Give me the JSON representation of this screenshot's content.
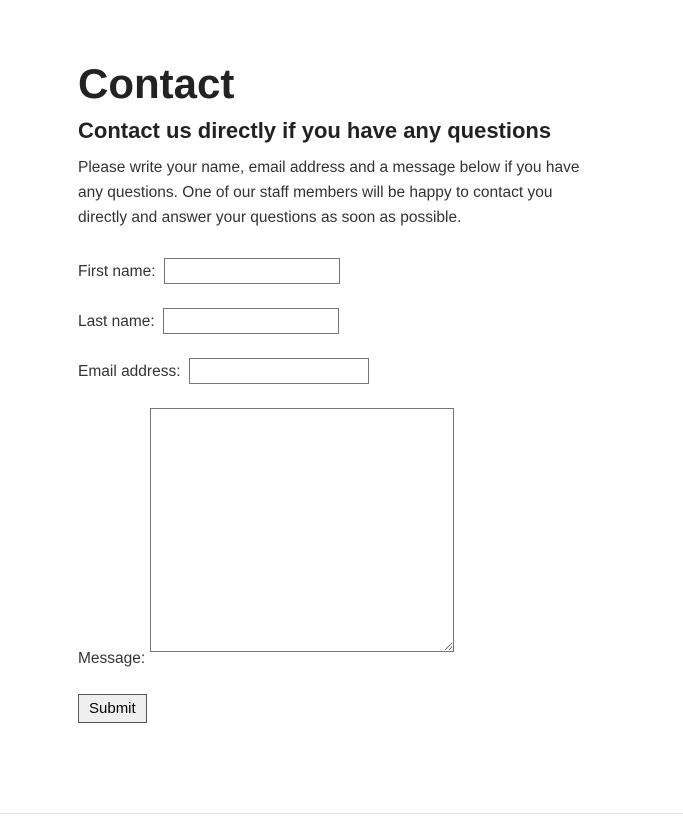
{
  "heading": "Contact",
  "subheading": "Contact us directly if you have any questions",
  "intro": "Please write your name, email address and a message below if you have any questions. One of our staff members will be happy to contact you directly and answer your questions as soon as possible.",
  "form": {
    "first_name_label": "First name:",
    "first_name_value": "",
    "last_name_label": "Last name:",
    "last_name_value": "",
    "email_label": "Email address:",
    "email_value": "",
    "message_label": "Message:",
    "message_value": "",
    "submit_label": "Submit"
  }
}
